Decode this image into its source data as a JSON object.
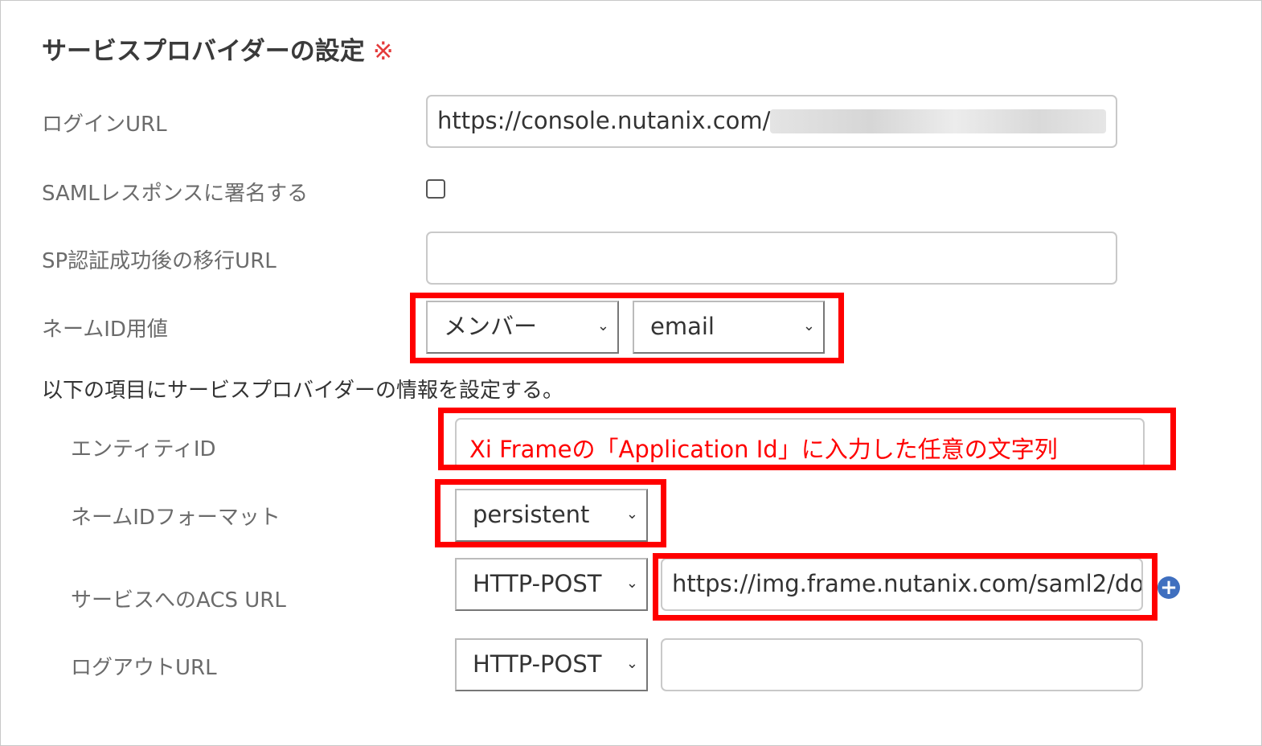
{
  "section": {
    "title": "サービスプロバイダーの設定",
    "required_mark": "※"
  },
  "login_url": {
    "label": "ログインURL",
    "value": "https://console.nutanix.com/t"
  },
  "saml_sign": {
    "label": "SAMLレスポンスに署名する",
    "checked": false
  },
  "sp_redirect_url": {
    "label": "SP認証成功後の移行URL",
    "value": ""
  },
  "name_id_value": {
    "label": "ネームID用値",
    "select1": "メンバー",
    "select2": "email"
  },
  "instruction": "以下の項目にサービスプロバイダーの情報を設定する。",
  "entity_id": {
    "label": "エンティティID",
    "value": "Xi Frameの「Application Id」に入力した任意の文字列"
  },
  "name_id_format": {
    "label": "ネームIDフォーマット",
    "value": "persistent"
  },
  "acs_url": {
    "label": "サービスへのACS URL",
    "binding": "HTTP-POST",
    "value": "https://img.frame.nutanix.com/saml2/do"
  },
  "logout_url": {
    "label": "ログアウトURL",
    "binding": "HTTP-POST",
    "value": ""
  },
  "icons": {
    "add": "plus-circle-icon",
    "chevron": "chevron-down-icon"
  },
  "colors": {
    "highlight": "#ff0000",
    "required": "#e43a3a",
    "add_button": "#3f6fbf"
  }
}
